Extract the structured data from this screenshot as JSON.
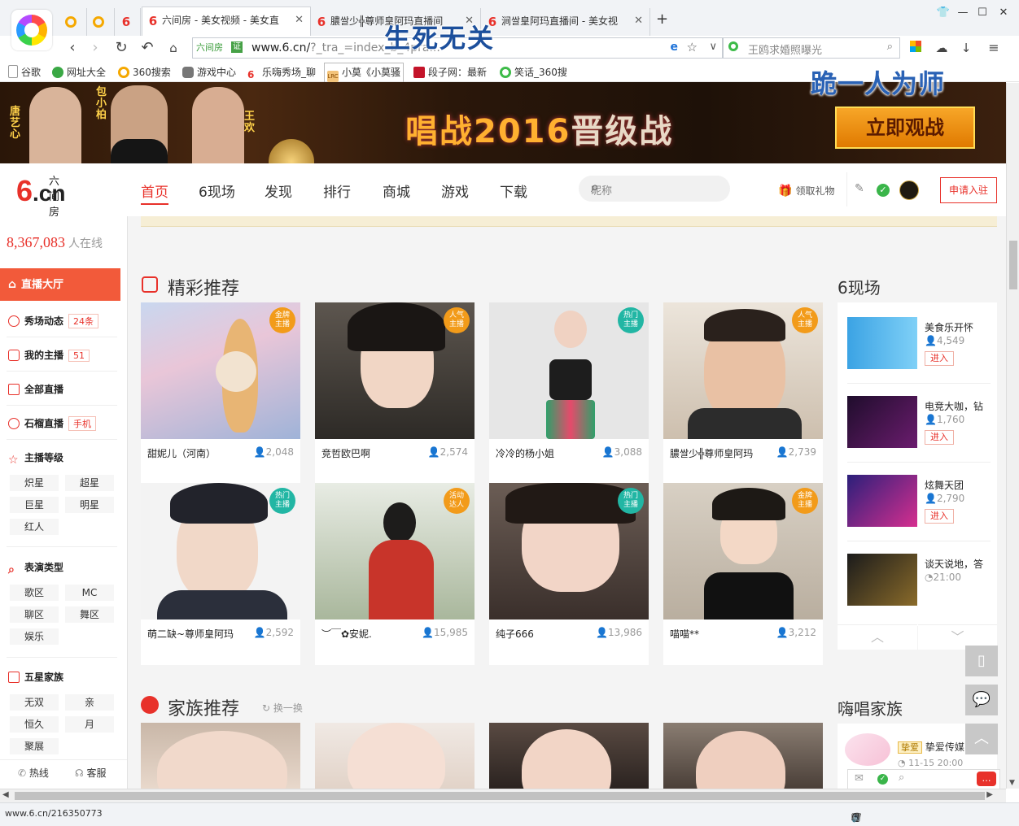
{
  "browser": {
    "tabs": [
      {
        "label": "",
        "icon": "qihoo-icon"
      },
      {
        "label": "",
        "icon": "qihoo-icon"
      },
      {
        "label": "",
        "icon": "six-icon"
      },
      {
        "label": "六间房 - 美女视频 - 美女直",
        "icon": "six-icon",
        "active": true
      },
      {
        "label": "膿쌀少╬尊师皇阿玛直播间",
        "icon": "six-icon"
      },
      {
        "label": "涧쌀皇阿玛直播间 - 美女视",
        "icon": "six-icon"
      }
    ],
    "new_tab": "+",
    "address": {
      "site_label": "六间房",
      "cert": "证",
      "url_main": "www.6.cn/",
      "url_rest": "?_tra_=index_b_4pra..."
    },
    "search_placeholder": "王鸥求婚照曝光",
    "overlay_1": "生死无关",
    "overlay_2": "跪一人为师",
    "bookmarks": [
      "谷歌",
      "网址大全",
      "360搜索",
      "游戏中心",
      "乐嗨秀场_聊",
      "小莫《小莫骚",
      "段子网：最新",
      "笑话_360搜"
    ],
    "status_url": "www.6.cn/216350773"
  },
  "banner": {
    "title_a": "唱战2016",
    "title_b": "晋级战",
    "cta": "立即观战",
    "names": [
      "唐艺心",
      "包小柏",
      "王欢"
    ]
  },
  "header": {
    "logo_small": "六间房",
    "logo_big": "6",
    "logo_cn": ".cn",
    "nav": [
      "首页",
      "6现场",
      "发现",
      "排行",
      "商城",
      "游戏",
      "下载"
    ],
    "search_placeholder": "昵称",
    "gift": "领取礼物",
    "apply": "申请入驻"
  },
  "sidebar": {
    "online_count": "8,367,083",
    "online_suffix": "人在线",
    "active_item": "直播大厅",
    "items": [
      {
        "label": "秀场动态",
        "badge": "24条"
      },
      {
        "label": "我的主播",
        "badge": "51"
      },
      {
        "label": "全部直播",
        "badge": ""
      },
      {
        "label": "石榴直播",
        "badge": "手机"
      }
    ],
    "level_title": "主播等级",
    "levels": [
      "炽星",
      "超星",
      "巨星",
      "明星",
      "红人"
    ],
    "type_title": "表演类型",
    "types": [
      "歌区",
      "MC",
      "聊区",
      "舞区",
      "娱乐"
    ],
    "family_title": "五星家族",
    "families": [
      "无双",
      "亲",
      "恒久",
      "月",
      "聚展"
    ],
    "hotline": "热线",
    "service": "客服"
  },
  "featured": {
    "title": "精彩推荐",
    "cards": [
      {
        "name": "甜妮儿（河南）",
        "count": "2,048",
        "flag": "金牌\n主播",
        "flag_color": "orange"
      },
      {
        "name": "竞哲欧巴啊",
        "count": "2,574",
        "flag": "人气\n主播",
        "flag_color": "orange"
      },
      {
        "name": "冷冷的杨小姐",
        "count": "3,088",
        "flag": "热门\n主播",
        "flag_color": "teal"
      },
      {
        "name": "膿쌀少╬尊师皇阿玛",
        "count": "2,739",
        "flag": "人气\n主播",
        "flag_color": "orange"
      },
      {
        "name": "萌二缺~尊师皇阿玛",
        "count": "2,592",
        "flag": "热门\n主播",
        "flag_color": "teal"
      },
      {
        "name": "︶￣✿安妮.",
        "count": "15,985",
        "flag": "活动\n达人",
        "flag_color": "orange"
      },
      {
        "name": "纯子666",
        "count": "13,986",
        "flag": "热门\n主播",
        "flag_color": "teal"
      },
      {
        "name": "喵喵**",
        "count": "3,212",
        "flag": "金牌\n主播",
        "flag_color": "orange"
      }
    ]
  },
  "family": {
    "title": "家族推荐",
    "refresh": "换一换"
  },
  "live6": {
    "title": "6现场",
    "items": [
      {
        "title": "美食乐开怀",
        "count": "4,549",
        "btn": "进入"
      },
      {
        "title": "电竞大咖，钻",
        "count": "1,760",
        "btn": "进入"
      },
      {
        "title": "炫舞天团",
        "count": "2,790",
        "btn": "进入"
      },
      {
        "title": "谈天说地，答",
        "count": "21:00",
        "btn": ""
      }
    ]
  },
  "haichang": {
    "title": "嗨唱家族",
    "item_tag": "挚爱",
    "item_name": "挚爱传媒",
    "item_time": "11-15 20:00"
  }
}
